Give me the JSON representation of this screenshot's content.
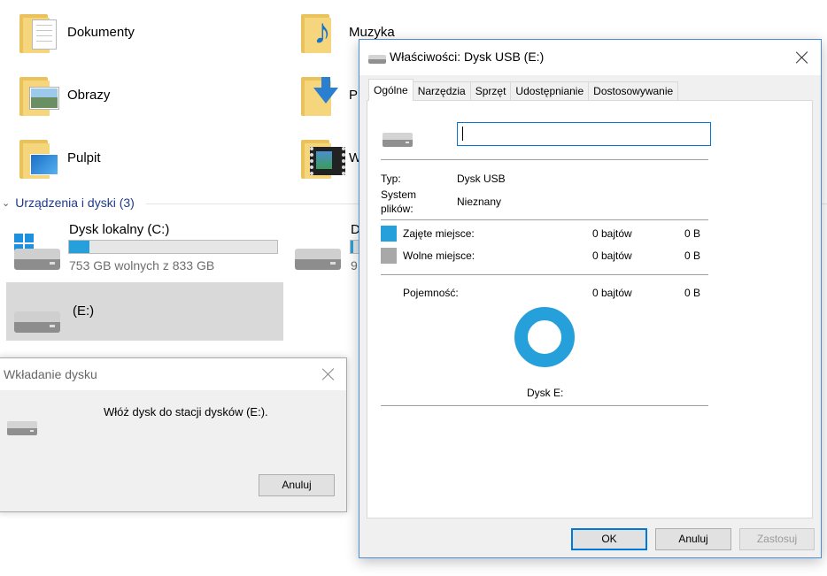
{
  "explorer": {
    "folders": [
      {
        "name": "Dokumenty",
        "icon": "documents-folder-icon"
      },
      {
        "name": "Muzyka",
        "icon": "music-folder-icon"
      },
      {
        "name": "Obrazy",
        "icon": "pictures-folder-icon"
      },
      {
        "name": "P",
        "icon": "downloads-folder-icon"
      },
      {
        "name": "Pulpit",
        "icon": "desktop-folder-icon"
      },
      {
        "name": "W",
        "icon": "videos-folder-icon"
      }
    ],
    "group_header": "Urządzenia i dyski (3)",
    "drives": [
      {
        "name": "Dysk lokalny (C:)",
        "free_text": "753 GB wolnych z 833 GB",
        "used_fraction": 0.096
      },
      {
        "name": "D",
        "free_text": "9",
        "used_fraction": 0.1
      },
      {
        "name": "(E:)"
      }
    ]
  },
  "insert_dialog": {
    "title": "Wkładanie dysku",
    "message": "Włóż dysk do stacji dysków  (E:).",
    "cancel_label": "Anuluj"
  },
  "properties_dialog": {
    "title": "Właściwości: Dysk USB (E:)",
    "tabs": [
      "Ogólne",
      "Narzędzia",
      "Sprzęt",
      "Udostępnianie",
      "Dostosowywanie"
    ],
    "active_tab": "Ogólne",
    "name_value": "",
    "type_label": "Typ:",
    "type_value": "Dysk USB",
    "fs_label_1": "System",
    "fs_label_2": "plików:",
    "fs_value": "Nieznany",
    "used_label": "Zajęte miejsce:",
    "used_bytes": "0 bajtów",
    "used_short": "0 B",
    "free_label": "Wolne miejsce:",
    "free_bytes": "0 bajtów",
    "free_short": "0 B",
    "capacity_label": "Pojemność:",
    "capacity_bytes": "0 bajtów",
    "capacity_short": "0 B",
    "disk_label": "Dysk E:",
    "ok_label": "OK",
    "cancel_label": "Anuluj",
    "apply_label": "Zastosuj"
  },
  "colors": {
    "used": "#26a0da",
    "free": "#a8a8a8",
    "accent": "#0078d7"
  }
}
